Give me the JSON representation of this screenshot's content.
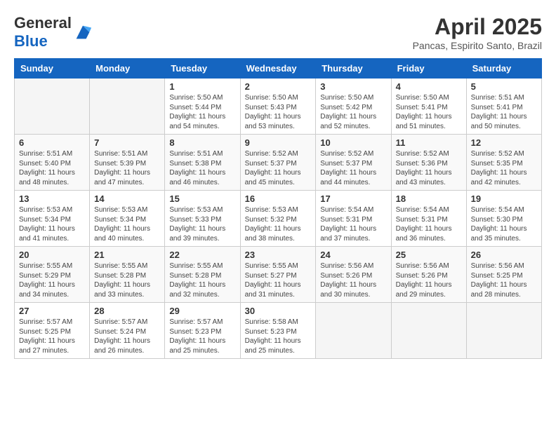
{
  "header": {
    "logo_general": "General",
    "logo_blue": "Blue",
    "title": "April 2025",
    "location": "Pancas, Espirito Santo, Brazil"
  },
  "calendar": {
    "days_of_week": [
      "Sunday",
      "Monday",
      "Tuesday",
      "Wednesday",
      "Thursday",
      "Friday",
      "Saturday"
    ],
    "weeks": [
      [
        {
          "day": "",
          "info": ""
        },
        {
          "day": "",
          "info": ""
        },
        {
          "day": "1",
          "info": "Sunrise: 5:50 AM\nSunset: 5:44 PM\nDaylight: 11 hours and 54 minutes."
        },
        {
          "day": "2",
          "info": "Sunrise: 5:50 AM\nSunset: 5:43 PM\nDaylight: 11 hours and 53 minutes."
        },
        {
          "day": "3",
          "info": "Sunrise: 5:50 AM\nSunset: 5:42 PM\nDaylight: 11 hours and 52 minutes."
        },
        {
          "day": "4",
          "info": "Sunrise: 5:50 AM\nSunset: 5:41 PM\nDaylight: 11 hours and 51 minutes."
        },
        {
          "day": "5",
          "info": "Sunrise: 5:51 AM\nSunset: 5:41 PM\nDaylight: 11 hours and 50 minutes."
        }
      ],
      [
        {
          "day": "6",
          "info": "Sunrise: 5:51 AM\nSunset: 5:40 PM\nDaylight: 11 hours and 48 minutes."
        },
        {
          "day": "7",
          "info": "Sunrise: 5:51 AM\nSunset: 5:39 PM\nDaylight: 11 hours and 47 minutes."
        },
        {
          "day": "8",
          "info": "Sunrise: 5:51 AM\nSunset: 5:38 PM\nDaylight: 11 hours and 46 minutes."
        },
        {
          "day": "9",
          "info": "Sunrise: 5:52 AM\nSunset: 5:37 PM\nDaylight: 11 hours and 45 minutes."
        },
        {
          "day": "10",
          "info": "Sunrise: 5:52 AM\nSunset: 5:37 PM\nDaylight: 11 hours and 44 minutes."
        },
        {
          "day": "11",
          "info": "Sunrise: 5:52 AM\nSunset: 5:36 PM\nDaylight: 11 hours and 43 minutes."
        },
        {
          "day": "12",
          "info": "Sunrise: 5:52 AM\nSunset: 5:35 PM\nDaylight: 11 hours and 42 minutes."
        }
      ],
      [
        {
          "day": "13",
          "info": "Sunrise: 5:53 AM\nSunset: 5:34 PM\nDaylight: 11 hours and 41 minutes."
        },
        {
          "day": "14",
          "info": "Sunrise: 5:53 AM\nSunset: 5:34 PM\nDaylight: 11 hours and 40 minutes."
        },
        {
          "day": "15",
          "info": "Sunrise: 5:53 AM\nSunset: 5:33 PM\nDaylight: 11 hours and 39 minutes."
        },
        {
          "day": "16",
          "info": "Sunrise: 5:53 AM\nSunset: 5:32 PM\nDaylight: 11 hours and 38 minutes."
        },
        {
          "day": "17",
          "info": "Sunrise: 5:54 AM\nSunset: 5:31 PM\nDaylight: 11 hours and 37 minutes."
        },
        {
          "day": "18",
          "info": "Sunrise: 5:54 AM\nSunset: 5:31 PM\nDaylight: 11 hours and 36 minutes."
        },
        {
          "day": "19",
          "info": "Sunrise: 5:54 AM\nSunset: 5:30 PM\nDaylight: 11 hours and 35 minutes."
        }
      ],
      [
        {
          "day": "20",
          "info": "Sunrise: 5:55 AM\nSunset: 5:29 PM\nDaylight: 11 hours and 34 minutes."
        },
        {
          "day": "21",
          "info": "Sunrise: 5:55 AM\nSunset: 5:28 PM\nDaylight: 11 hours and 33 minutes."
        },
        {
          "day": "22",
          "info": "Sunrise: 5:55 AM\nSunset: 5:28 PM\nDaylight: 11 hours and 32 minutes."
        },
        {
          "day": "23",
          "info": "Sunrise: 5:55 AM\nSunset: 5:27 PM\nDaylight: 11 hours and 31 minutes."
        },
        {
          "day": "24",
          "info": "Sunrise: 5:56 AM\nSunset: 5:26 PM\nDaylight: 11 hours and 30 minutes."
        },
        {
          "day": "25",
          "info": "Sunrise: 5:56 AM\nSunset: 5:26 PM\nDaylight: 11 hours and 29 minutes."
        },
        {
          "day": "26",
          "info": "Sunrise: 5:56 AM\nSunset: 5:25 PM\nDaylight: 11 hours and 28 minutes."
        }
      ],
      [
        {
          "day": "27",
          "info": "Sunrise: 5:57 AM\nSunset: 5:25 PM\nDaylight: 11 hours and 27 minutes."
        },
        {
          "day": "28",
          "info": "Sunrise: 5:57 AM\nSunset: 5:24 PM\nDaylight: 11 hours and 26 minutes."
        },
        {
          "day": "29",
          "info": "Sunrise: 5:57 AM\nSunset: 5:23 PM\nDaylight: 11 hours and 25 minutes."
        },
        {
          "day": "30",
          "info": "Sunrise: 5:58 AM\nSunset: 5:23 PM\nDaylight: 11 hours and 25 minutes."
        },
        {
          "day": "",
          "info": ""
        },
        {
          "day": "",
          "info": ""
        },
        {
          "day": "",
          "info": ""
        }
      ]
    ]
  }
}
